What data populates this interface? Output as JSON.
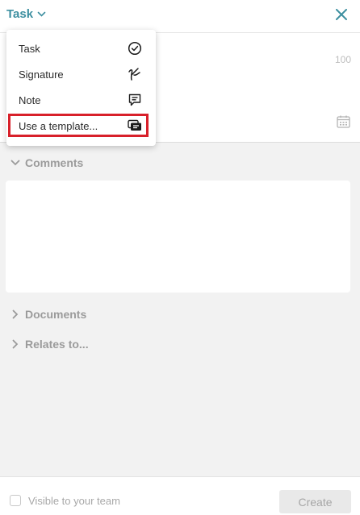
{
  "header": {
    "title": "Task",
    "icons": {
      "dropdown": "chevron-down-icon",
      "close": "close-icon"
    },
    "accent_color": "#3d8fa0"
  },
  "form": {
    "char_count": "100",
    "date_icon": "calendar-icon"
  },
  "dropdown_menu": {
    "items": [
      {
        "label": "Task",
        "icon": "check-circle-icon"
      },
      {
        "label": "Signature",
        "icon": "signature-icon"
      },
      {
        "label": "Note",
        "icon": "note-icon"
      },
      {
        "label": "Use a template...",
        "icon": "template-icon",
        "highlighted": true
      }
    ],
    "highlight_color": "#d8202a"
  },
  "sections": {
    "comments": {
      "label": "Comments",
      "expanded": true
    },
    "documents": {
      "label": "Documents",
      "expanded": false
    },
    "relates_to": {
      "label": "Relates to...",
      "expanded": false
    }
  },
  "footer": {
    "visible_label": "Visible to your team",
    "visible_checked": false,
    "create_label": "Create"
  }
}
